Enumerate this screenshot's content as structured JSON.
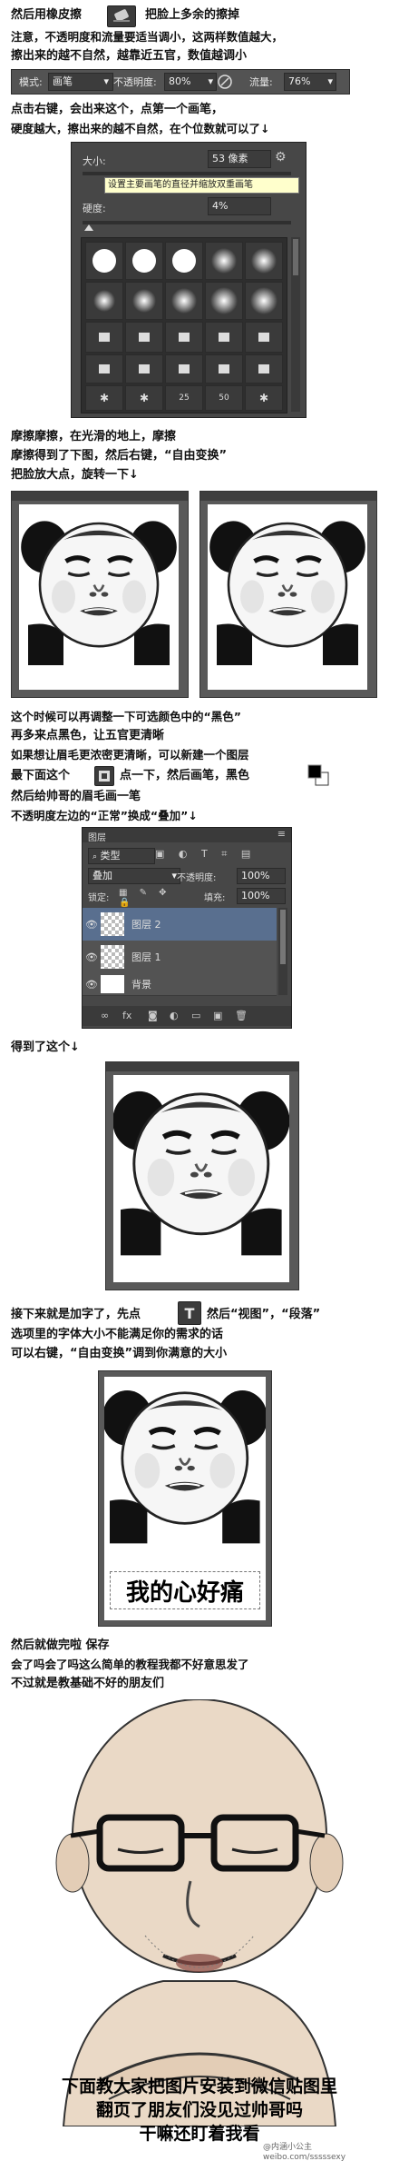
{
  "intro": {
    "line1_a": "然后用橡皮擦",
    "line1_b": "把脸上多余的擦掉",
    "line2": "注意，不透明度和流量要适当调小，这两样数值越大，",
    "line3": "擦出来的越不自然，越靠近五官，数值越调小"
  },
  "options_bar": {
    "mode_label": "模式:",
    "mode_value": "画笔",
    "opacity_label": "不透明度:",
    "opacity_value": "80%",
    "flow_label": "流量:",
    "flow_value": "76%"
  },
  "step2": {
    "line1": "点击右键，会出来这个，点第一个画笔，",
    "line2": "硬度越大，擦出来的越不自然，在个位数就可以了↓"
  },
  "brush_panel": {
    "size_label": "大小:",
    "size_value": "53 像素",
    "tooltip": "设置主要画笔的直径并缩放双重画笔",
    "hardness_label": "硬度:",
    "hardness_value": "4%",
    "preset_sizes": [
      "25",
      "50"
    ]
  },
  "step3": {
    "line1": "摩擦摩擦，在光滑的地上，摩擦",
    "line2": "摩擦得到了下图，然后右键，“自由变换”",
    "line3": "把脸放大点，旋转一下↓"
  },
  "step4": {
    "line1": "这个时候可以再调整一下可选颜色中的“黑色”",
    "line2": "再多来点黑色，让五官更清晰",
    "line3": "如果想让眉毛更浓密更清晰，可以新建一个图层",
    "line4_a": "最下面这个",
    "line4_b": "点一下，然后画笔，黑色",
    "line5": "然后给帅哥的眉毛画一笔",
    "line6": "不透明度左边的“正常”换成“叠加”↓"
  },
  "layers_panel": {
    "tab": "图层",
    "filter_label": "类型",
    "blend_mode": "叠加",
    "opacity_label": "不透明度:",
    "opacity_value": "100%",
    "lock_label": "锁定:",
    "fill_label": "填充:",
    "fill_value": "100%",
    "layers": [
      "图层 2",
      "图层 1",
      "背景"
    ]
  },
  "step5": {
    "line1": "得到了这个↓"
  },
  "step6": {
    "line1_a": "接下来就是加字了，先点",
    "line1_b": "然后“视图”，“段落”",
    "line2": "选项里的字体大小不能满足你的需求的话",
    "line3": "可以右键，“自由变换”调到你满意的大小"
  },
  "meme_caption": "我的心好痛",
  "step7": {
    "line1": "然后就做完啦 保存",
    "line2": "会了吗会了吗这么简单的教程我都不好意思发了",
    "line3": "不过就是教基础不好的朋友们"
  },
  "final": {
    "line1": "下面教大家把图片安装到微信贴图里",
    "line2": "翻页了朋友们没见过帅哥吗",
    "line3": "干嘛还盯着我看",
    "watermark": "@内涵小公主",
    "watermark_url": "weibo.com/sssssexy"
  },
  "colors": {
    "ps_dark": "#535353",
    "ps_darker": "#3c3c3c",
    "selection_blue": "#596f8f",
    "tooltip_yellow": "#ffffcc"
  }
}
